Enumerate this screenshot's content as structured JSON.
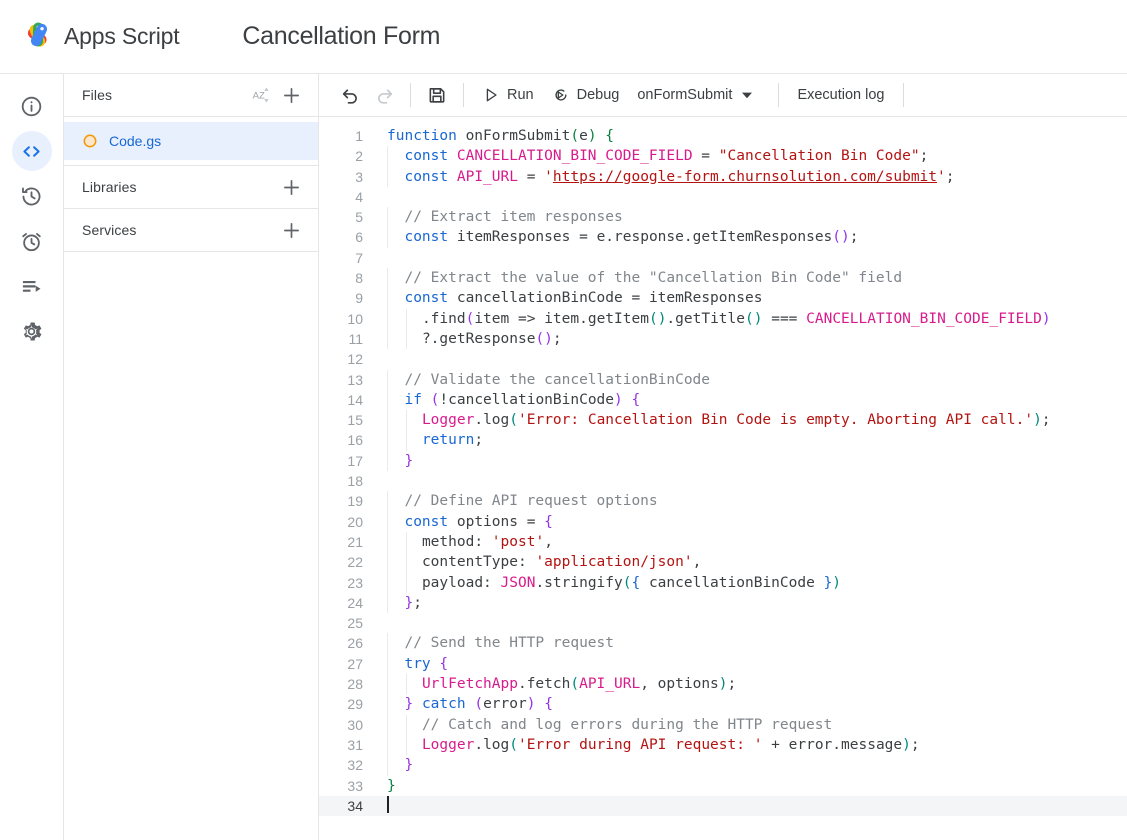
{
  "header": {
    "logo_icon": "apps-script-logo",
    "brand": "Apps Script",
    "project_title": "Cancellation Form"
  },
  "rail": {
    "items": [
      {
        "icon": "info-icon",
        "label": "Overview",
        "active": false
      },
      {
        "icon": "code-icon",
        "label": "Editor",
        "active": true
      },
      {
        "icon": "history-icon",
        "label": "Project History",
        "active": false
      },
      {
        "icon": "alarm-clock-icon",
        "label": "Triggers",
        "active": false
      },
      {
        "icon": "executions-icon",
        "label": "Executions",
        "active": false
      },
      {
        "icon": "gear-icon",
        "label": "Project Settings",
        "active": false
      }
    ]
  },
  "files_panel": {
    "files_header": "Files",
    "sort_icon": "sort-az-icon",
    "add_icon": "plus-icon",
    "files": [
      {
        "name": "Code.gs",
        "icon": "gs-file-icon",
        "selected": true
      }
    ],
    "sections": [
      {
        "title": "Libraries",
        "add_icon": "plus-icon"
      },
      {
        "title": "Services",
        "add_icon": "plus-icon"
      }
    ]
  },
  "toolbar": {
    "undo_icon": "undo-icon",
    "redo_icon": "redo-icon",
    "save_icon": "save-icon",
    "run_icon": "play-icon",
    "run_label": "Run",
    "debug_icon": "debug-icon",
    "debug_label": "Debug",
    "function_select_value": "onFormSubmit",
    "function_select_caret": "chevron-down-icon",
    "execution_log_label": "Execution log"
  },
  "editor": {
    "filename": "Code.gs",
    "language": "javascript",
    "cursor_line": 34,
    "total_lines": 34,
    "colors": {
      "keyword": "#1967d2",
      "class": "#d81b8c",
      "string": "#b31412",
      "comment": "#80868b",
      "plain": "#3c4043",
      "line_number": "#9aa0a6",
      "active_line_bg": "#f4f5f7",
      "selection_bg": "#e8f0fe"
    },
    "lines": [
      {
        "n": 1,
        "text": "function onFormSubmit(e) {"
      },
      {
        "n": 2,
        "text": "  const CANCELLATION_BIN_CODE_FIELD = \"Cancellation Bin Code\";"
      },
      {
        "n": 3,
        "text": "  const API_URL = 'https://google-form.churnsolution.com/submit';"
      },
      {
        "n": 4,
        "text": ""
      },
      {
        "n": 5,
        "text": "  // Extract item responses"
      },
      {
        "n": 6,
        "text": "  const itemResponses = e.response.getItemResponses();"
      },
      {
        "n": 7,
        "text": ""
      },
      {
        "n": 8,
        "text": "  // Extract the value of the \"Cancellation Bin Code\" field"
      },
      {
        "n": 9,
        "text": "  const cancellationBinCode = itemResponses"
      },
      {
        "n": 10,
        "text": "    .find(item => item.getItem().getTitle() === CANCELLATION_BIN_CODE_FIELD)"
      },
      {
        "n": 11,
        "text": "    ?.getResponse();"
      },
      {
        "n": 12,
        "text": ""
      },
      {
        "n": 13,
        "text": "  // Validate the cancellationBinCode"
      },
      {
        "n": 14,
        "text": "  if (!cancellationBinCode) {"
      },
      {
        "n": 15,
        "text": "    Logger.log('Error: Cancellation Bin Code is empty. Aborting API call.');"
      },
      {
        "n": 16,
        "text": "    return;"
      },
      {
        "n": 17,
        "text": "  }"
      },
      {
        "n": 18,
        "text": ""
      },
      {
        "n": 19,
        "text": "  // Define API request options"
      },
      {
        "n": 20,
        "text": "  const options = {"
      },
      {
        "n": 21,
        "text": "    method: 'post',"
      },
      {
        "n": 22,
        "text": "    contentType: 'application/json',"
      },
      {
        "n": 23,
        "text": "    payload: JSON.stringify({ cancellationBinCode })"
      },
      {
        "n": 24,
        "text": "  };"
      },
      {
        "n": 25,
        "text": ""
      },
      {
        "n": 26,
        "text": "  // Send the HTTP request"
      },
      {
        "n": 27,
        "text": "  try {"
      },
      {
        "n": 28,
        "text": "    UrlFetchApp.fetch(API_URL, options);"
      },
      {
        "n": 29,
        "text": "  } catch (error) {"
      },
      {
        "n": 30,
        "text": "    // Catch and log errors during the HTTP request"
      },
      {
        "n": 31,
        "text": "    Logger.log('Error during API request: ' + error.message);"
      },
      {
        "n": 32,
        "text": "  }"
      },
      {
        "n": 33,
        "text": "}"
      },
      {
        "n": 34,
        "text": ""
      }
    ]
  }
}
